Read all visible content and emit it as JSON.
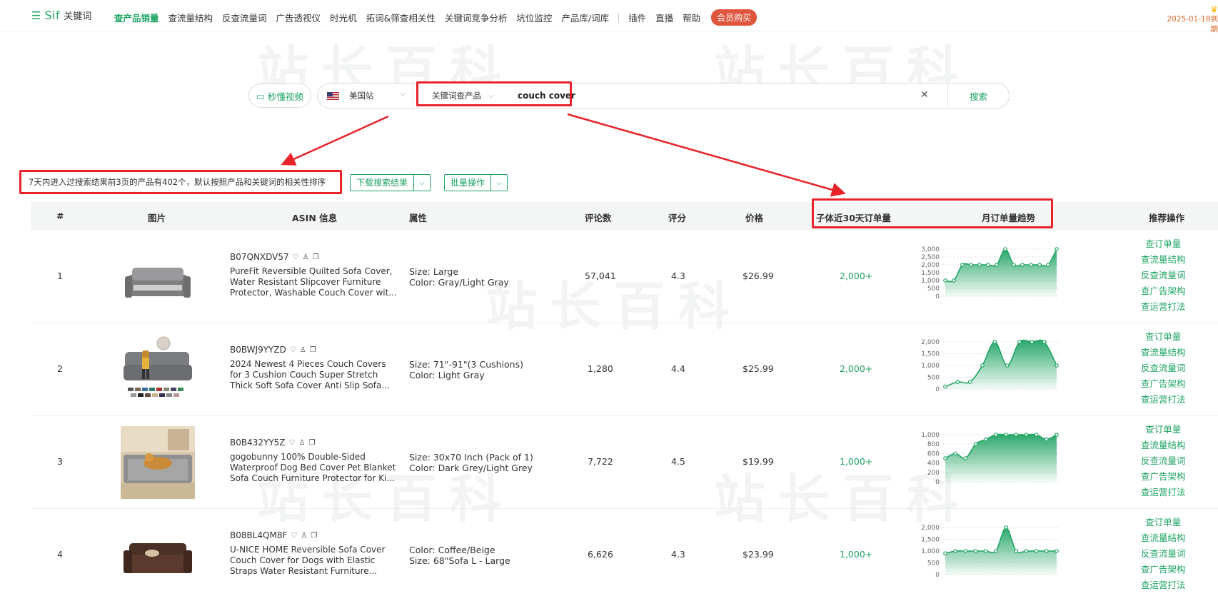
{
  "nav": {
    "brand": "Sif",
    "product": "关键词",
    "items": [
      "查产品销量",
      "查流量结构",
      "反查流量词",
      "广告透视仪",
      "时光机",
      "拓词&筛查相关性",
      "关键词竞争分析",
      "坑位监控",
      "产品库/词库"
    ],
    "extra_items": [
      "插件",
      "直播",
      "帮助"
    ],
    "vip": "会员购买",
    "expire": "2025-01-18到期"
  },
  "watermark": "站长百科",
  "search": {
    "video_btn": "秒懂视频",
    "site": "美国站",
    "mode": "关键词查产品",
    "keyword": "couch cover",
    "search_btn": "搜索"
  },
  "summary": {
    "text": "7天内进入过搜索结果前3页的产品有402个，默认按照产品和关键词的相关性排序",
    "download_btn": "下载搜索结果",
    "batch_btn": "批量操作"
  },
  "table": {
    "headers": [
      "#",
      "图片",
      "ASIN 信息",
      "属性",
      "评论数",
      "评分",
      "价格",
      "子体近30天订单量",
      "月订单量趋势",
      "推荐操作"
    ],
    "ops": [
      "查订单量",
      "查流量结构",
      "反查流量词",
      "查广告架构",
      "查运营打法"
    ],
    "rows": [
      {
        "idx": "1",
        "asin": "B07QNXDV57",
        "title": [
          "PureFit Reversible Quilted Sofa Cover,",
          "Water Resistant Slipcover Furniture",
          "Protector, Washable Couch Cover wit..."
        ],
        "attrs": [
          "Size: Large",
          "Color: Gray/Light Gray"
        ],
        "reviews": "57,041",
        "rating": "4.3",
        "price": "$26.99",
        "orders": "2,000+",
        "trend": [
          1000,
          1000,
          2000,
          2000,
          2000,
          2000,
          2000,
          3000,
          2000,
          2000,
          2000,
          2000,
          2000,
          3000
        ],
        "ylabels": [
          "3,000",
          "2,500",
          "2,000",
          "1,500",
          "1,000",
          "500",
          "0"
        ],
        "ymax": 3000
      },
      {
        "idx": "2",
        "asin": "B0BWJ9YYZD",
        "title": [
          "2024 Newest 4 Pieces Couch Covers",
          "for 3 Cushion Couch Super Stretch",
          "Thick Soft Sofa Cover Anti Slip Sofa..."
        ],
        "attrs": [
          "Size: 71\"-91\"(3 Cushions)",
          "Color: Light Gray"
        ],
        "reviews": "1,280",
        "rating": "4.4",
        "price": "$25.99",
        "orders": "2,000+",
        "trend": [
          100,
          300,
          300,
          1000,
          2000,
          1000,
          2000,
          2000,
          2000,
          1000
        ],
        "ylabels": [
          "2,000",
          "1,500",
          "1,000",
          "500",
          "0"
        ],
        "ymax": 2000
      },
      {
        "idx": "3",
        "asin": "B0B432YY5Z",
        "title": [
          "gogobunny 100% Double-Sided",
          "Waterproof Dog Bed Cover Pet Blanket",
          "Sofa Couch Furniture Protector for Ki..."
        ],
        "attrs": [
          "Size: 30x70 Inch (Pack of 1)",
          "Color: Dark Grey/Light Grey"
        ],
        "reviews": "7,722",
        "rating": "4.5",
        "price": "$19.99",
        "orders": "1,000+",
        "trend": [
          500,
          600,
          500,
          800,
          900,
          1000,
          1000,
          1000,
          1000,
          1000,
          900,
          1000
        ],
        "ylabels": [
          "1,000",
          "800",
          "600",
          "400",
          "200",
          "0"
        ],
        "ymax": 1000
      },
      {
        "idx": "4",
        "asin": "B08BL4QM8F",
        "title": [
          "U-NICE HOME Reversible Sofa Cover",
          "Couch Cover for Dogs with Elastic",
          "Straps Water Resistant Furniture..."
        ],
        "attrs": [
          "Color: Coffee/Beige",
          "Size: 68\"Sofa L - Large"
        ],
        "reviews": "6,626",
        "rating": "4.3",
        "price": "$23.99",
        "orders": "1,000+",
        "trend": [
          900,
          1000,
          1000,
          1000,
          1000,
          1000,
          2000,
          1000,
          1000,
          1000,
          1000,
          1000
        ],
        "ylabels": [
          "2,000",
          "1,500",
          "1,000",
          "500",
          "0"
        ],
        "ymax": 2000
      }
    ]
  },
  "colors": {
    "accent": "#1fa463",
    "annotation": "#e8232a",
    "vip": "#e0553d"
  }
}
